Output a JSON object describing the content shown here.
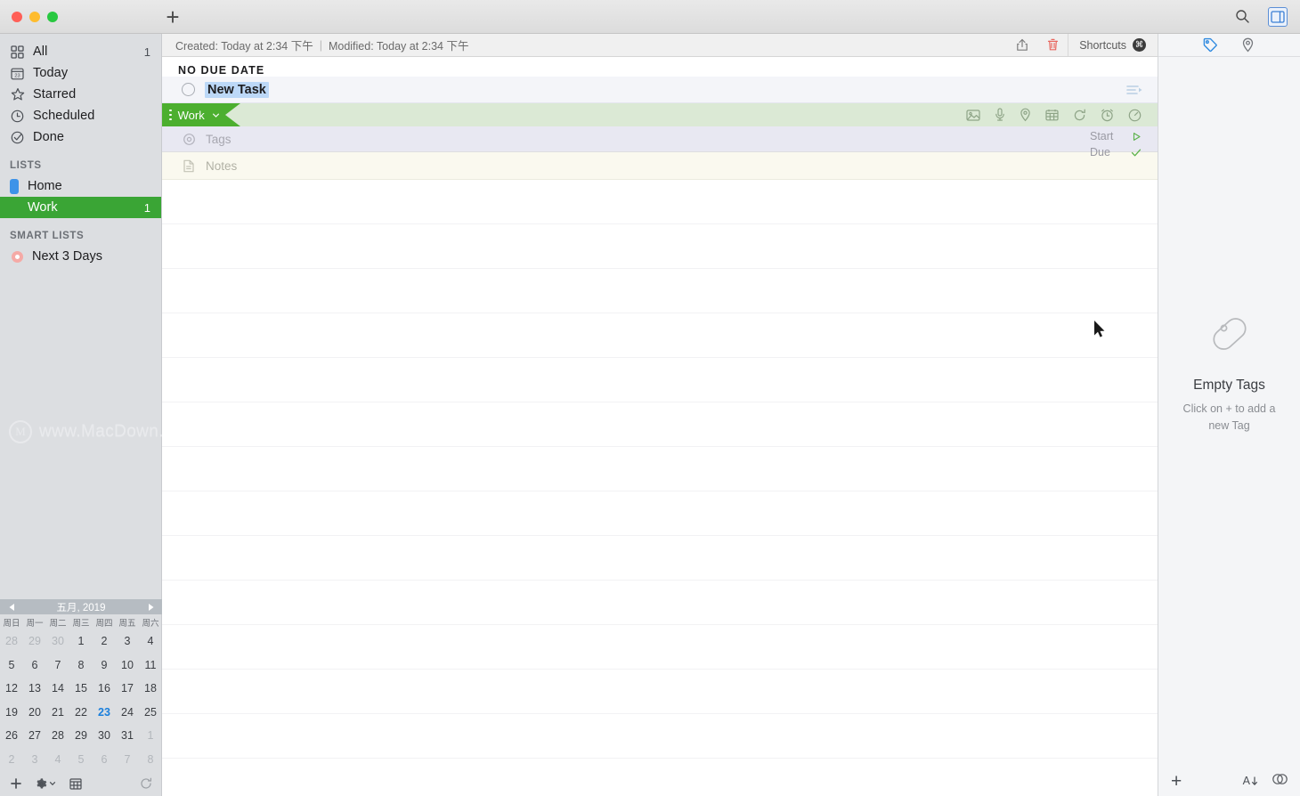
{
  "titlebar": {
    "add_button": "+",
    "search_icon": "search-icon",
    "sidebar_toggle_icon": "sidebar-toggle-icon"
  },
  "sidebar": {
    "nav": [
      {
        "label": "All",
        "icon": "grid-icon",
        "count": "1"
      },
      {
        "label": "Today",
        "icon": "calendar-23-icon",
        "count": ""
      },
      {
        "label": "Starred",
        "icon": "star-icon",
        "count": ""
      },
      {
        "label": "Scheduled",
        "icon": "clock-icon",
        "count": ""
      },
      {
        "label": "Done",
        "icon": "check-circle-icon",
        "count": ""
      }
    ],
    "lists_header": "LISTS",
    "lists": [
      {
        "label": "Home",
        "color": "#3d93e8",
        "count": "",
        "selected": false
      },
      {
        "label": "Work",
        "color": "#3aa535",
        "count": "1",
        "selected": true
      }
    ],
    "smart_header": "SMART LISTS",
    "smart_lists": [
      {
        "label": "Next 3 Days",
        "color": "#f5aaa6"
      }
    ],
    "watermark": "www.MacDown.com"
  },
  "calendar": {
    "title": "五月, 2019",
    "prev_icon": "chevron-left-icon",
    "next_icon": "chevron-right-icon",
    "dow": [
      "周日",
      "周一",
      "周二",
      "周三",
      "周四",
      "周五",
      "周六"
    ],
    "weeks": [
      [
        {
          "d": "28",
          "m": true
        },
        {
          "d": "29",
          "m": true
        },
        {
          "d": "30",
          "m": true
        },
        {
          "d": "1"
        },
        {
          "d": "2"
        },
        {
          "d": "3"
        },
        {
          "d": "4"
        }
      ],
      [
        {
          "d": "5"
        },
        {
          "d": "6"
        },
        {
          "d": "7"
        },
        {
          "d": "8"
        },
        {
          "d": "9"
        },
        {
          "d": "10"
        },
        {
          "d": "11"
        }
      ],
      [
        {
          "d": "12"
        },
        {
          "d": "13"
        },
        {
          "d": "14"
        },
        {
          "d": "15"
        },
        {
          "d": "16"
        },
        {
          "d": "17"
        },
        {
          "d": "18"
        }
      ],
      [
        {
          "d": "19"
        },
        {
          "d": "20"
        },
        {
          "d": "21"
        },
        {
          "d": "22"
        },
        {
          "d": "23",
          "today": true
        },
        {
          "d": "24"
        },
        {
          "d": "25"
        }
      ],
      [
        {
          "d": "26"
        },
        {
          "d": "27"
        },
        {
          "d": "28"
        },
        {
          "d": "29"
        },
        {
          "d": "30"
        },
        {
          "d": "31"
        },
        {
          "d": "1",
          "m": true
        }
      ],
      [
        {
          "d": "2",
          "m": true
        },
        {
          "d": "3",
          "m": true
        },
        {
          "d": "4",
          "m": true
        },
        {
          "d": "5",
          "m": true
        },
        {
          "d": "6",
          "m": true
        },
        {
          "d": "7",
          "m": true
        },
        {
          "d": "8",
          "m": true
        }
      ]
    ],
    "today_color": "#1a7fdc",
    "footer": {
      "add_icon": "plus-icon",
      "settings_icon": "gear-icon",
      "view_icon": "calendar-view-icon",
      "refresh_icon": "refresh-icon"
    }
  },
  "infobar": {
    "created": "Created: Today at 2:34 下午",
    "separator": "|",
    "modified": "Modified: Today at 2:34 下午",
    "share_icon": "share-icon",
    "trash_icon": "trash-icon",
    "trash_color": "#e8665e",
    "shortcuts_label": "Shortcuts",
    "shortcuts_badge": "⌘"
  },
  "main": {
    "section_header": "NO DUE DATE",
    "task": {
      "title": "New Task",
      "checkbox_icon": "circle-checkbox-icon",
      "selected_text_color": "#bcd8f7",
      "subtask_icon": "subtask-list-icon",
      "list_tag": "Work",
      "list_tag_color": "#4caf2f",
      "tag_chevron_icon": "chevron-down-icon",
      "drag_handle_icon": "drag-dots-icon",
      "attachment_icons": [
        "image-icon",
        "microphone-icon",
        "location-pin-icon",
        "calendar-icon",
        "repeat-icon",
        "alarm-clock-icon",
        "priority-gauge-icon"
      ],
      "tags_placeholder": "Tags",
      "tags_icon": "tag-target-icon",
      "notes_placeholder": "Notes",
      "notes_icon": "notes-page-icon",
      "start_label": "Start",
      "start_icon": "play-triangle-icon",
      "due_label": "Due",
      "due_icon": "check-icon",
      "date_marker_color": "#5bb24a"
    }
  },
  "rightpanel": {
    "tabs": [
      {
        "icon": "tag-icon",
        "active": true
      },
      {
        "icon": "location-pin-icon",
        "active": false
      }
    ],
    "empty_icon": "tag-outline-icon",
    "empty_title": "Empty Tags",
    "empty_subtitle": "Click on + to add a new Tag",
    "footer": {
      "add_icon": "plus-icon",
      "sort_icon": "sort-az-icon",
      "visibility_icon": "eye-icon"
    }
  }
}
